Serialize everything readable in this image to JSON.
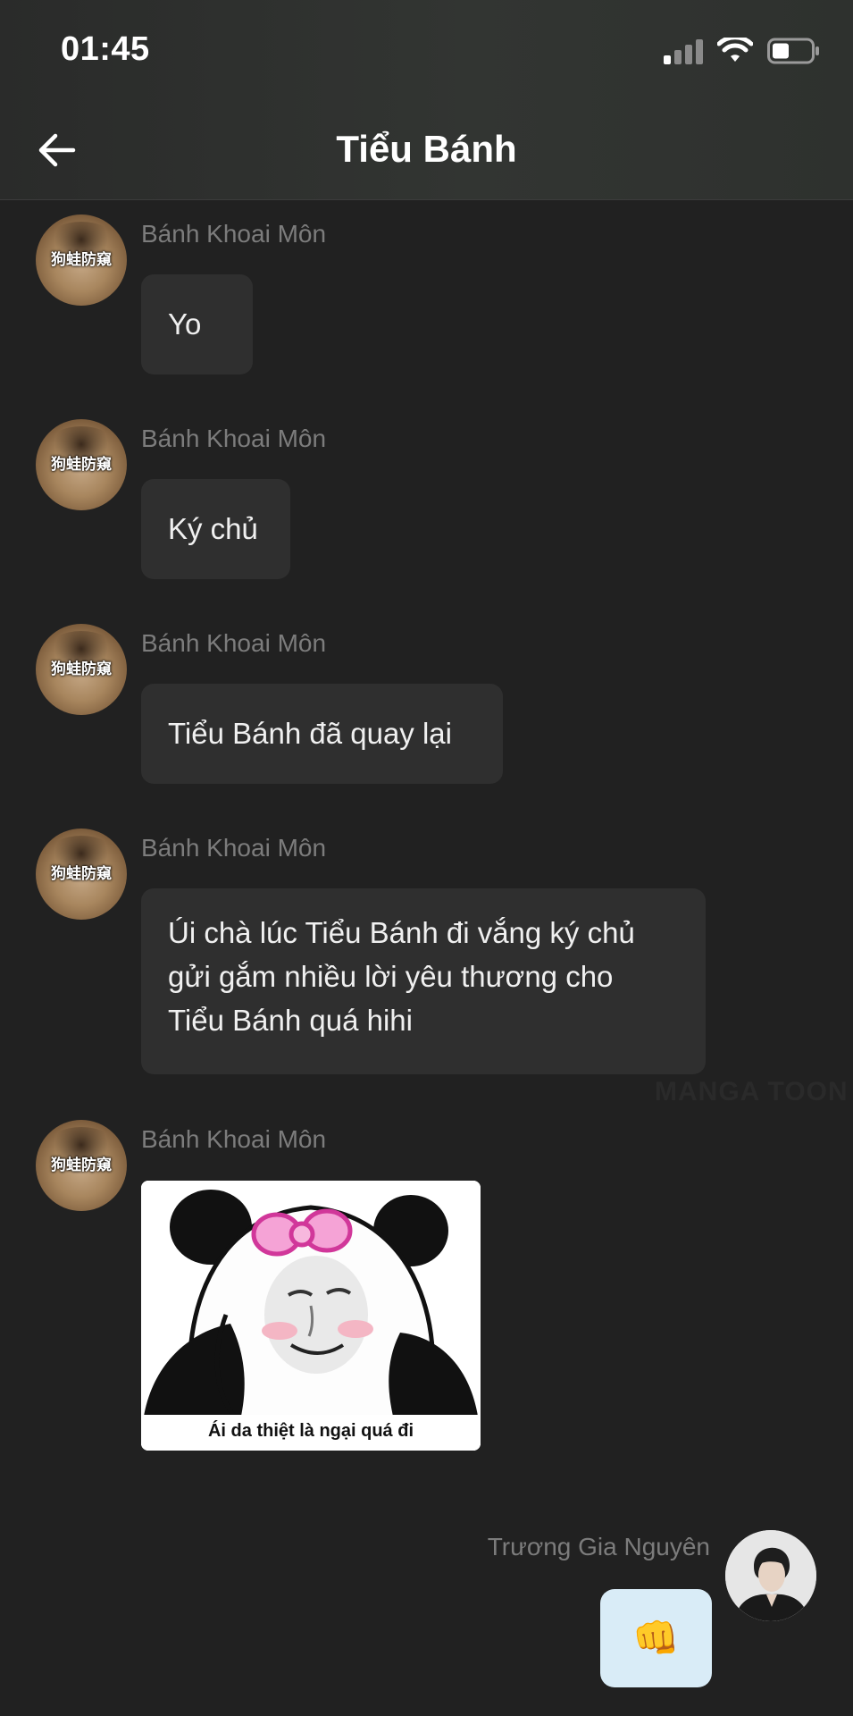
{
  "status_bar": {
    "time": "01:45"
  },
  "header": {
    "title": "Tiểu Bánh"
  },
  "messages": [
    {
      "sender": "Bánh Khoai Môn",
      "text": "Yo"
    },
    {
      "sender": "Bánh Khoai Môn",
      "text": "Ký chủ"
    },
    {
      "sender": "Bánh Khoai Môn",
      "text": "Tiểu Bánh đã quay lại"
    },
    {
      "sender": "Bánh Khoai Môn",
      "lines": [
        "Úi chà lúc Tiểu Bánh đi vắng ký chủ",
        "gửi gắm nhiều lời yêu thương cho",
        "Tiểu Bánh quá hihi"
      ]
    },
    {
      "sender": "Bánh Khoai Môn",
      "sticker_caption": "Ái da thiệt là ngại quá đi"
    },
    {
      "sender": "Trương Gia Nguyên",
      "emoji": "👊"
    }
  ],
  "avatar_overlay_text": "狗蛙防窺",
  "watermark": "MANGA TOON",
  "colors": {
    "background": "#212121",
    "bubble": "#2f2f2f",
    "sender_name": "#7c7c7c",
    "own_bubble": "#d9ecf7"
  }
}
